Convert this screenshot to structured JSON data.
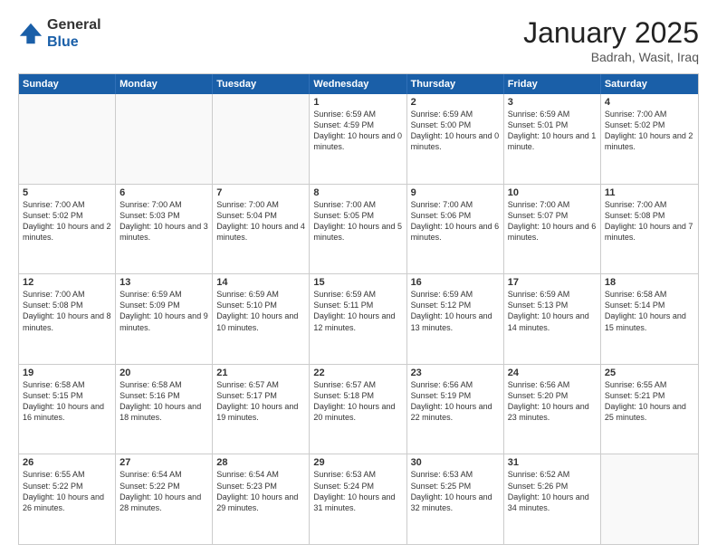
{
  "header": {
    "logo": {
      "line1": "General",
      "line2": "Blue"
    },
    "title": "January 2025",
    "location": "Badrah, Wasit, Iraq"
  },
  "dayHeaders": [
    "Sunday",
    "Monday",
    "Tuesday",
    "Wednesday",
    "Thursday",
    "Friday",
    "Saturday"
  ],
  "weeks": [
    [
      {
        "day": "",
        "sunrise": "",
        "sunset": "",
        "daylight": ""
      },
      {
        "day": "",
        "sunrise": "",
        "sunset": "",
        "daylight": ""
      },
      {
        "day": "",
        "sunrise": "",
        "sunset": "",
        "daylight": ""
      },
      {
        "day": "1",
        "sunrise": "Sunrise: 6:59 AM",
        "sunset": "Sunset: 4:59 PM",
        "daylight": "Daylight: 10 hours and 0 minutes."
      },
      {
        "day": "2",
        "sunrise": "Sunrise: 6:59 AM",
        "sunset": "Sunset: 5:00 PM",
        "daylight": "Daylight: 10 hours and 0 minutes."
      },
      {
        "day": "3",
        "sunrise": "Sunrise: 6:59 AM",
        "sunset": "Sunset: 5:01 PM",
        "daylight": "Daylight: 10 hours and 1 minute."
      },
      {
        "day": "4",
        "sunrise": "Sunrise: 7:00 AM",
        "sunset": "Sunset: 5:02 PM",
        "daylight": "Daylight: 10 hours and 2 minutes."
      }
    ],
    [
      {
        "day": "5",
        "sunrise": "Sunrise: 7:00 AM",
        "sunset": "Sunset: 5:02 PM",
        "daylight": "Daylight: 10 hours and 2 minutes."
      },
      {
        "day": "6",
        "sunrise": "Sunrise: 7:00 AM",
        "sunset": "Sunset: 5:03 PM",
        "daylight": "Daylight: 10 hours and 3 minutes."
      },
      {
        "day": "7",
        "sunrise": "Sunrise: 7:00 AM",
        "sunset": "Sunset: 5:04 PM",
        "daylight": "Daylight: 10 hours and 4 minutes."
      },
      {
        "day": "8",
        "sunrise": "Sunrise: 7:00 AM",
        "sunset": "Sunset: 5:05 PM",
        "daylight": "Daylight: 10 hours and 5 minutes."
      },
      {
        "day": "9",
        "sunrise": "Sunrise: 7:00 AM",
        "sunset": "Sunset: 5:06 PM",
        "daylight": "Daylight: 10 hours and 6 minutes."
      },
      {
        "day": "10",
        "sunrise": "Sunrise: 7:00 AM",
        "sunset": "Sunset: 5:07 PM",
        "daylight": "Daylight: 10 hours and 6 minutes."
      },
      {
        "day": "11",
        "sunrise": "Sunrise: 7:00 AM",
        "sunset": "Sunset: 5:08 PM",
        "daylight": "Daylight: 10 hours and 7 minutes."
      }
    ],
    [
      {
        "day": "12",
        "sunrise": "Sunrise: 7:00 AM",
        "sunset": "Sunset: 5:08 PM",
        "daylight": "Daylight: 10 hours and 8 minutes."
      },
      {
        "day": "13",
        "sunrise": "Sunrise: 6:59 AM",
        "sunset": "Sunset: 5:09 PM",
        "daylight": "Daylight: 10 hours and 9 minutes."
      },
      {
        "day": "14",
        "sunrise": "Sunrise: 6:59 AM",
        "sunset": "Sunset: 5:10 PM",
        "daylight": "Daylight: 10 hours and 10 minutes."
      },
      {
        "day": "15",
        "sunrise": "Sunrise: 6:59 AM",
        "sunset": "Sunset: 5:11 PM",
        "daylight": "Daylight: 10 hours and 12 minutes."
      },
      {
        "day": "16",
        "sunrise": "Sunrise: 6:59 AM",
        "sunset": "Sunset: 5:12 PM",
        "daylight": "Daylight: 10 hours and 13 minutes."
      },
      {
        "day": "17",
        "sunrise": "Sunrise: 6:59 AM",
        "sunset": "Sunset: 5:13 PM",
        "daylight": "Daylight: 10 hours and 14 minutes."
      },
      {
        "day": "18",
        "sunrise": "Sunrise: 6:58 AM",
        "sunset": "Sunset: 5:14 PM",
        "daylight": "Daylight: 10 hours and 15 minutes."
      }
    ],
    [
      {
        "day": "19",
        "sunrise": "Sunrise: 6:58 AM",
        "sunset": "Sunset: 5:15 PM",
        "daylight": "Daylight: 10 hours and 16 minutes."
      },
      {
        "day": "20",
        "sunrise": "Sunrise: 6:58 AM",
        "sunset": "Sunset: 5:16 PM",
        "daylight": "Daylight: 10 hours and 18 minutes."
      },
      {
        "day": "21",
        "sunrise": "Sunrise: 6:57 AM",
        "sunset": "Sunset: 5:17 PM",
        "daylight": "Daylight: 10 hours and 19 minutes."
      },
      {
        "day": "22",
        "sunrise": "Sunrise: 6:57 AM",
        "sunset": "Sunset: 5:18 PM",
        "daylight": "Daylight: 10 hours and 20 minutes."
      },
      {
        "day": "23",
        "sunrise": "Sunrise: 6:56 AM",
        "sunset": "Sunset: 5:19 PM",
        "daylight": "Daylight: 10 hours and 22 minutes."
      },
      {
        "day": "24",
        "sunrise": "Sunrise: 6:56 AM",
        "sunset": "Sunset: 5:20 PM",
        "daylight": "Daylight: 10 hours and 23 minutes."
      },
      {
        "day": "25",
        "sunrise": "Sunrise: 6:55 AM",
        "sunset": "Sunset: 5:21 PM",
        "daylight": "Daylight: 10 hours and 25 minutes."
      }
    ],
    [
      {
        "day": "26",
        "sunrise": "Sunrise: 6:55 AM",
        "sunset": "Sunset: 5:22 PM",
        "daylight": "Daylight: 10 hours and 26 minutes."
      },
      {
        "day": "27",
        "sunrise": "Sunrise: 6:54 AM",
        "sunset": "Sunset: 5:22 PM",
        "daylight": "Daylight: 10 hours and 28 minutes."
      },
      {
        "day": "28",
        "sunrise": "Sunrise: 6:54 AM",
        "sunset": "Sunset: 5:23 PM",
        "daylight": "Daylight: 10 hours and 29 minutes."
      },
      {
        "day": "29",
        "sunrise": "Sunrise: 6:53 AM",
        "sunset": "Sunset: 5:24 PM",
        "daylight": "Daylight: 10 hours and 31 minutes."
      },
      {
        "day": "30",
        "sunrise": "Sunrise: 6:53 AM",
        "sunset": "Sunset: 5:25 PM",
        "daylight": "Daylight: 10 hours and 32 minutes."
      },
      {
        "day": "31",
        "sunrise": "Sunrise: 6:52 AM",
        "sunset": "Sunset: 5:26 PM",
        "daylight": "Daylight: 10 hours and 34 minutes."
      },
      {
        "day": "",
        "sunrise": "",
        "sunset": "",
        "daylight": ""
      }
    ]
  ]
}
